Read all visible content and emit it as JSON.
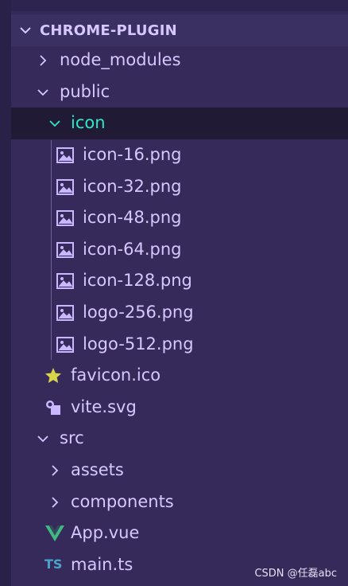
{
  "explorer": {
    "root_label": "CHROME-PLUGIN",
    "items": [
      {
        "label": "node_modules",
        "kind": "folder-collapsed"
      },
      {
        "label": "public",
        "kind": "folder-expanded"
      },
      {
        "label": "icon",
        "kind": "folder-expanded",
        "selected": true
      },
      {
        "label": "icon-16.png",
        "kind": "image-file"
      },
      {
        "label": "icon-32.png",
        "kind": "image-file"
      },
      {
        "label": "icon-48.png",
        "kind": "image-file"
      },
      {
        "label": "icon-64.png",
        "kind": "image-file"
      },
      {
        "label": "icon-128.png",
        "kind": "image-file"
      },
      {
        "label": "logo-256.png",
        "kind": "image-file"
      },
      {
        "label": "logo-512.png",
        "kind": "image-file"
      },
      {
        "label": "favicon.ico",
        "kind": "favicon-file"
      },
      {
        "label": "vite.svg",
        "kind": "svg-file"
      },
      {
        "label": "src",
        "kind": "folder-expanded"
      },
      {
        "label": "assets",
        "kind": "folder-collapsed"
      },
      {
        "label": "components",
        "kind": "folder-collapsed"
      },
      {
        "label": "App.vue",
        "kind": "vue-file"
      },
      {
        "label": "main.ts",
        "kind": "typescript-file"
      }
    ]
  },
  "icons": {
    "ts_badge": "TS"
  },
  "watermark": "CSDN @任磊abc",
  "colors": {
    "background": "#362a5a",
    "text": "#d6c8ff",
    "selected_text": "#2ee7c5",
    "selected_row": "#201a35",
    "star": "#d8d54a",
    "vue_green": "#41b883",
    "ts_blue": "#4aa3c9"
  }
}
